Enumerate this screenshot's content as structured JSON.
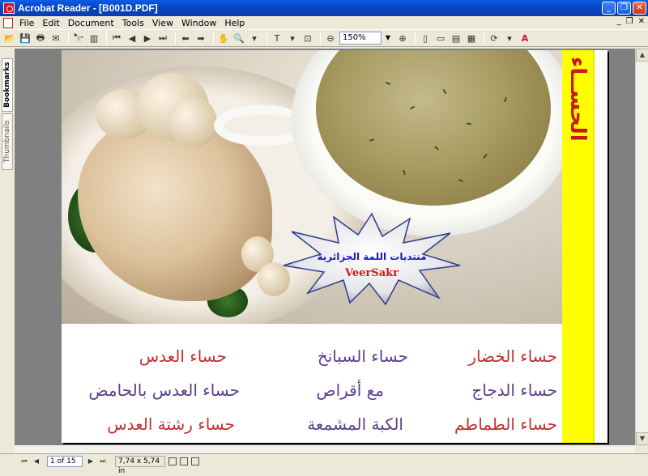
{
  "window": {
    "title": "Acrobat Reader - [B001D.PDF]",
    "minimize_glyph": "_",
    "maximize_glyph": "❐",
    "close_glyph": "✕"
  },
  "menu": {
    "items": [
      "File",
      "Edit",
      "Document",
      "Tools",
      "View",
      "Window",
      "Help"
    ],
    "mdi_minimize": "_",
    "mdi_restore": "❐",
    "mdi_close": "✕"
  },
  "toolbar": {
    "zoom_value": "150%"
  },
  "navpane": {
    "bookmarks_tab": "Bookmarks",
    "thumbnails_tab": "Thumbnails"
  },
  "page": {
    "side_title": "الحســاء",
    "watermark_line1": "منتديات اللمة الجزائرية",
    "watermark_line2": "VeerSakr",
    "recipes": {
      "r1c1": "حساء الخضار",
      "r1c2": "حساء السبانخ",
      "r1c3": "حساء العدس",
      "r2c1": "حساء الدجاج",
      "r2c2": "مع أقراص",
      "r2c3": "حساء العدس بالحامض",
      "r3c1": "حساء الطماطم",
      "r3c2": "الكبة المشمعة",
      "r3c3": "حساء رشتة العدس"
    },
    "colors": {
      "side_band": "#ffff00",
      "red_text": "#c03030",
      "purple_text": "#5a3e8c",
      "watermark_blue": "#1818c8",
      "watermark_red": "#d01818"
    }
  },
  "statusbar": {
    "page_indicator": "1 of 15",
    "page_size": "7,74 x 5,74 in"
  }
}
